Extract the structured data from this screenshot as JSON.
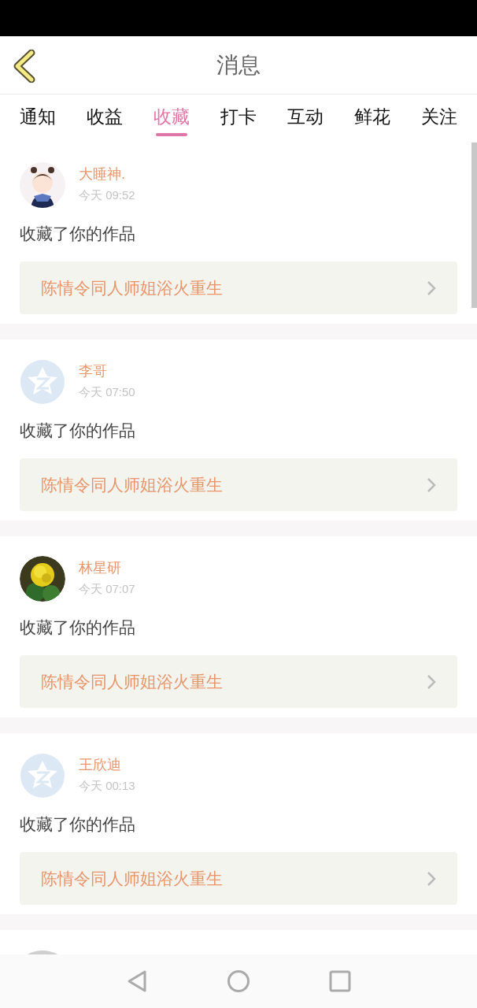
{
  "header": {
    "title": "消息"
  },
  "tabs": [
    {
      "label": "通知",
      "selected": false
    },
    {
      "label": "收益",
      "selected": false
    },
    {
      "label": "收藏",
      "selected": true
    },
    {
      "label": "打卡",
      "selected": false
    },
    {
      "label": "互动",
      "selected": false
    },
    {
      "label": "鲜花",
      "selected": false
    },
    {
      "label": "关注",
      "selected": false
    }
  ],
  "messages": [
    {
      "avatar": {
        "kind": "cartoon"
      },
      "name": "大睡神.",
      "time": "今天 09:52",
      "action": "收藏了你的作品",
      "work": "陈情令同人师姐浴火重生"
    },
    {
      "avatar": {
        "kind": "default"
      },
      "name": "李哥",
      "time": "今天 07:50",
      "action": "收藏了你的作品",
      "work": "陈情令同人师姐浴火重生"
    },
    {
      "avatar": {
        "kind": "flower"
      },
      "name": "林星研",
      "time": "今天 07:07",
      "action": "收藏了你的作品",
      "work": "陈情令同人师姐浴火重生"
    },
    {
      "avatar": {
        "kind": "default"
      },
      "name": "王欣迪",
      "time": "今天 00:13",
      "action": "收藏了你的作品",
      "work": "陈情令同人师姐浴火重生"
    },
    {
      "avatar": {
        "kind": "blank"
      }
    }
  ]
}
